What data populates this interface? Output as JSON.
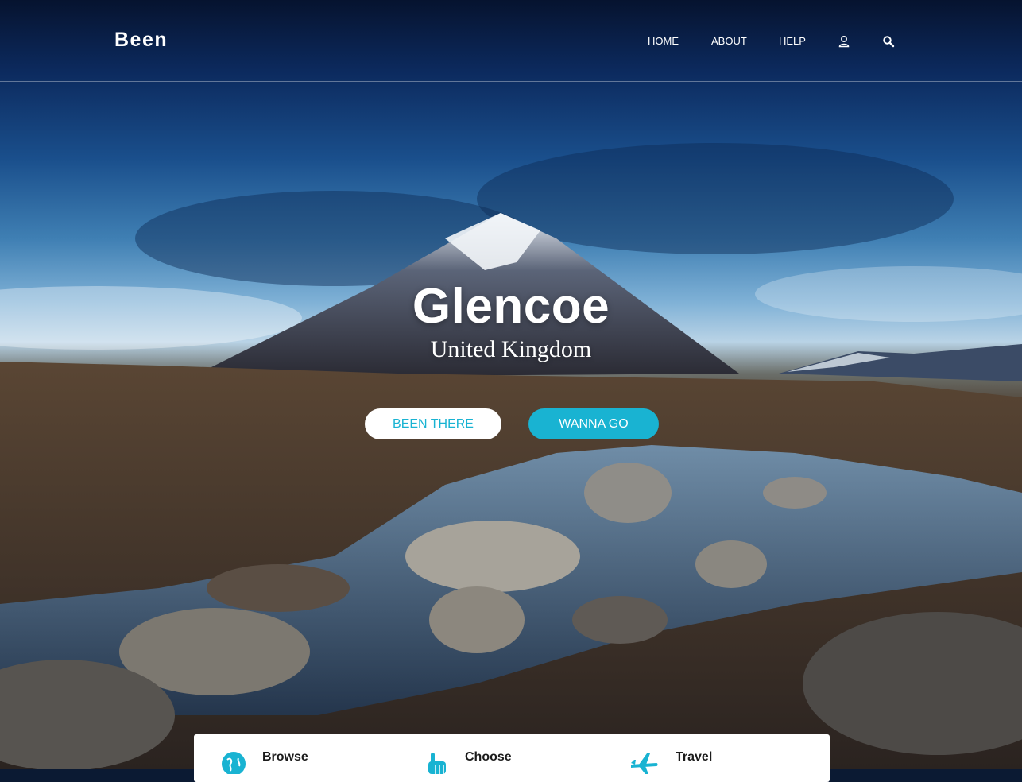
{
  "header": {
    "logo": "Been",
    "nav": {
      "home": "HOME",
      "about": "ABOUT",
      "help": "HELP"
    },
    "icons": [
      "user-icon",
      "search-icon"
    ]
  },
  "hero": {
    "title": "Glencoe",
    "subtitle": "United Kingdom",
    "buttons": {
      "been_there": "BEEN THERE",
      "wanna_go": "WANNA GO"
    }
  },
  "features": [
    {
      "title": "Browse",
      "icon": "globe-icon",
      "description": ""
    },
    {
      "title": "Choose",
      "icon": "pointer-hand-icon",
      "description": ""
    },
    {
      "title": "Travel",
      "icon": "airplane-icon",
      "description": ""
    }
  ],
  "colors": {
    "accent": "#19b3d2",
    "text_light": "#ffffff",
    "card_bg": "#ffffff"
  }
}
